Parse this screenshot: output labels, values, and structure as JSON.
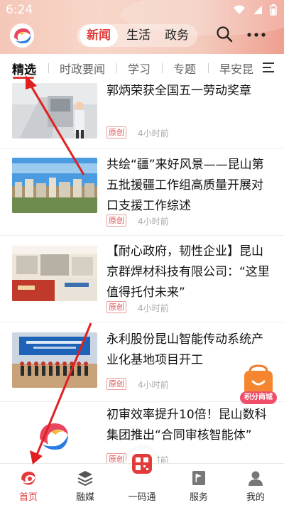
{
  "status_bar": {
    "time": "6:24"
  },
  "header": {
    "tabs": [
      {
        "label": "新闻",
        "active": true
      },
      {
        "label": "生活",
        "active": false
      },
      {
        "label": "政务",
        "active": false
      }
    ]
  },
  "categories": [
    {
      "label": "精选",
      "active": true
    },
    {
      "label": "时政要闻",
      "active": false
    },
    {
      "label": "学习",
      "active": false
    },
    {
      "label": "专题",
      "active": false
    },
    {
      "label": "早安昆",
      "active": false
    }
  ],
  "news": [
    {
      "title": "郭炳荣获全国五一劳动奖章",
      "badge": "原创",
      "time": "4小时前"
    },
    {
      "title": "共绘“疆”来好风景——昆山第五批援疆工作组高质量开展对口支援工作综述",
      "badge": "原创",
      "time": "4小时前"
    },
    {
      "title": "【耐心政府，韧性企业】昆山京群焊材科技有限公司：“这里值得托付未来”",
      "badge": "原创",
      "time": "4小时前"
    },
    {
      "title": "永利股份昆山智能传动系统产业化基地项目开工",
      "badge": "原创",
      "time": "4小时前"
    },
    {
      "title": "初审效率提升10倍！昆山数科集团推出“合同审核智能体”",
      "badge": "原创",
      "time": "4小时前"
    }
  ],
  "float_badge": {
    "label": "积分商城"
  },
  "bottom_nav": [
    {
      "label": "首页",
      "active": true
    },
    {
      "label": "融媒",
      "active": false
    },
    {
      "label": "一码通",
      "active": false
    },
    {
      "label": "服务",
      "active": false
    },
    {
      "label": "我的",
      "active": false
    }
  ],
  "colors": {
    "accent": "#e33a3a",
    "header_bg": "#f4c7b8"
  }
}
